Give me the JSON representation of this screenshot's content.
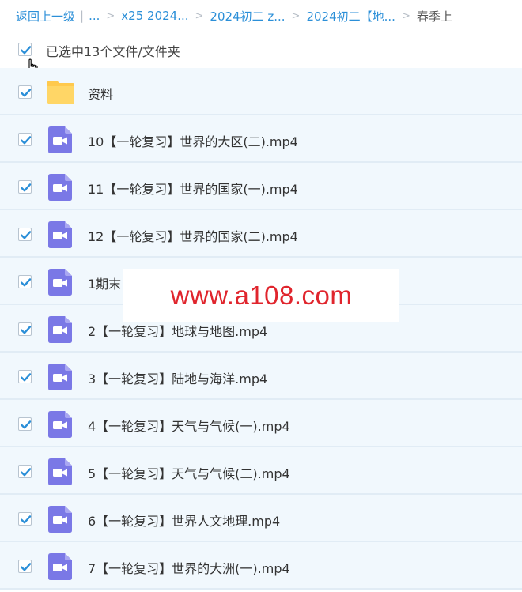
{
  "breadcrumb": {
    "back": "返回上一级",
    "pipe": "|",
    "ellipsis": "...",
    "items": [
      "x25 2024...",
      "2024初二 z...",
      "2024初二【地..."
    ],
    "current": "春季上",
    "separator": ">"
  },
  "selection": {
    "text": "已选中13个文件/文件夹",
    "checked": true
  },
  "files": [
    {
      "name": "资料",
      "type": "folder"
    },
    {
      "name": "10【一轮复习】世界的大区(二).mp4",
      "type": "video"
    },
    {
      "name": "11【一轮复习】世界的国家(一).mp4",
      "type": "video"
    },
    {
      "name": "12【一轮复习】世界的国家(二).mp4",
      "type": "video"
    },
    {
      "name": "1期末",
      "type": "video"
    },
    {
      "name": "2【一轮复习】地球与地图.mp4",
      "type": "video"
    },
    {
      "name": "3【一轮复习】陆地与海洋.mp4",
      "type": "video"
    },
    {
      "name": "4【一轮复习】天气与气候(一).mp4",
      "type": "video"
    },
    {
      "name": "5【一轮复习】天气与气候(二).mp4",
      "type": "video"
    },
    {
      "name": "6【一轮复习】世界人文地理.mp4",
      "type": "video"
    },
    {
      "name": "7【一轮复习】世界的大洲(一).mp4",
      "type": "video"
    }
  ],
  "watermark": "www.a108.com",
  "colors": {
    "link": "#2b8fd8",
    "check": "#2b8fd8",
    "row_bg": "#f1f8fd",
    "video_icon": "#7a78e6",
    "folder_icon": "#ffc94d",
    "watermark": "#e0252d"
  }
}
